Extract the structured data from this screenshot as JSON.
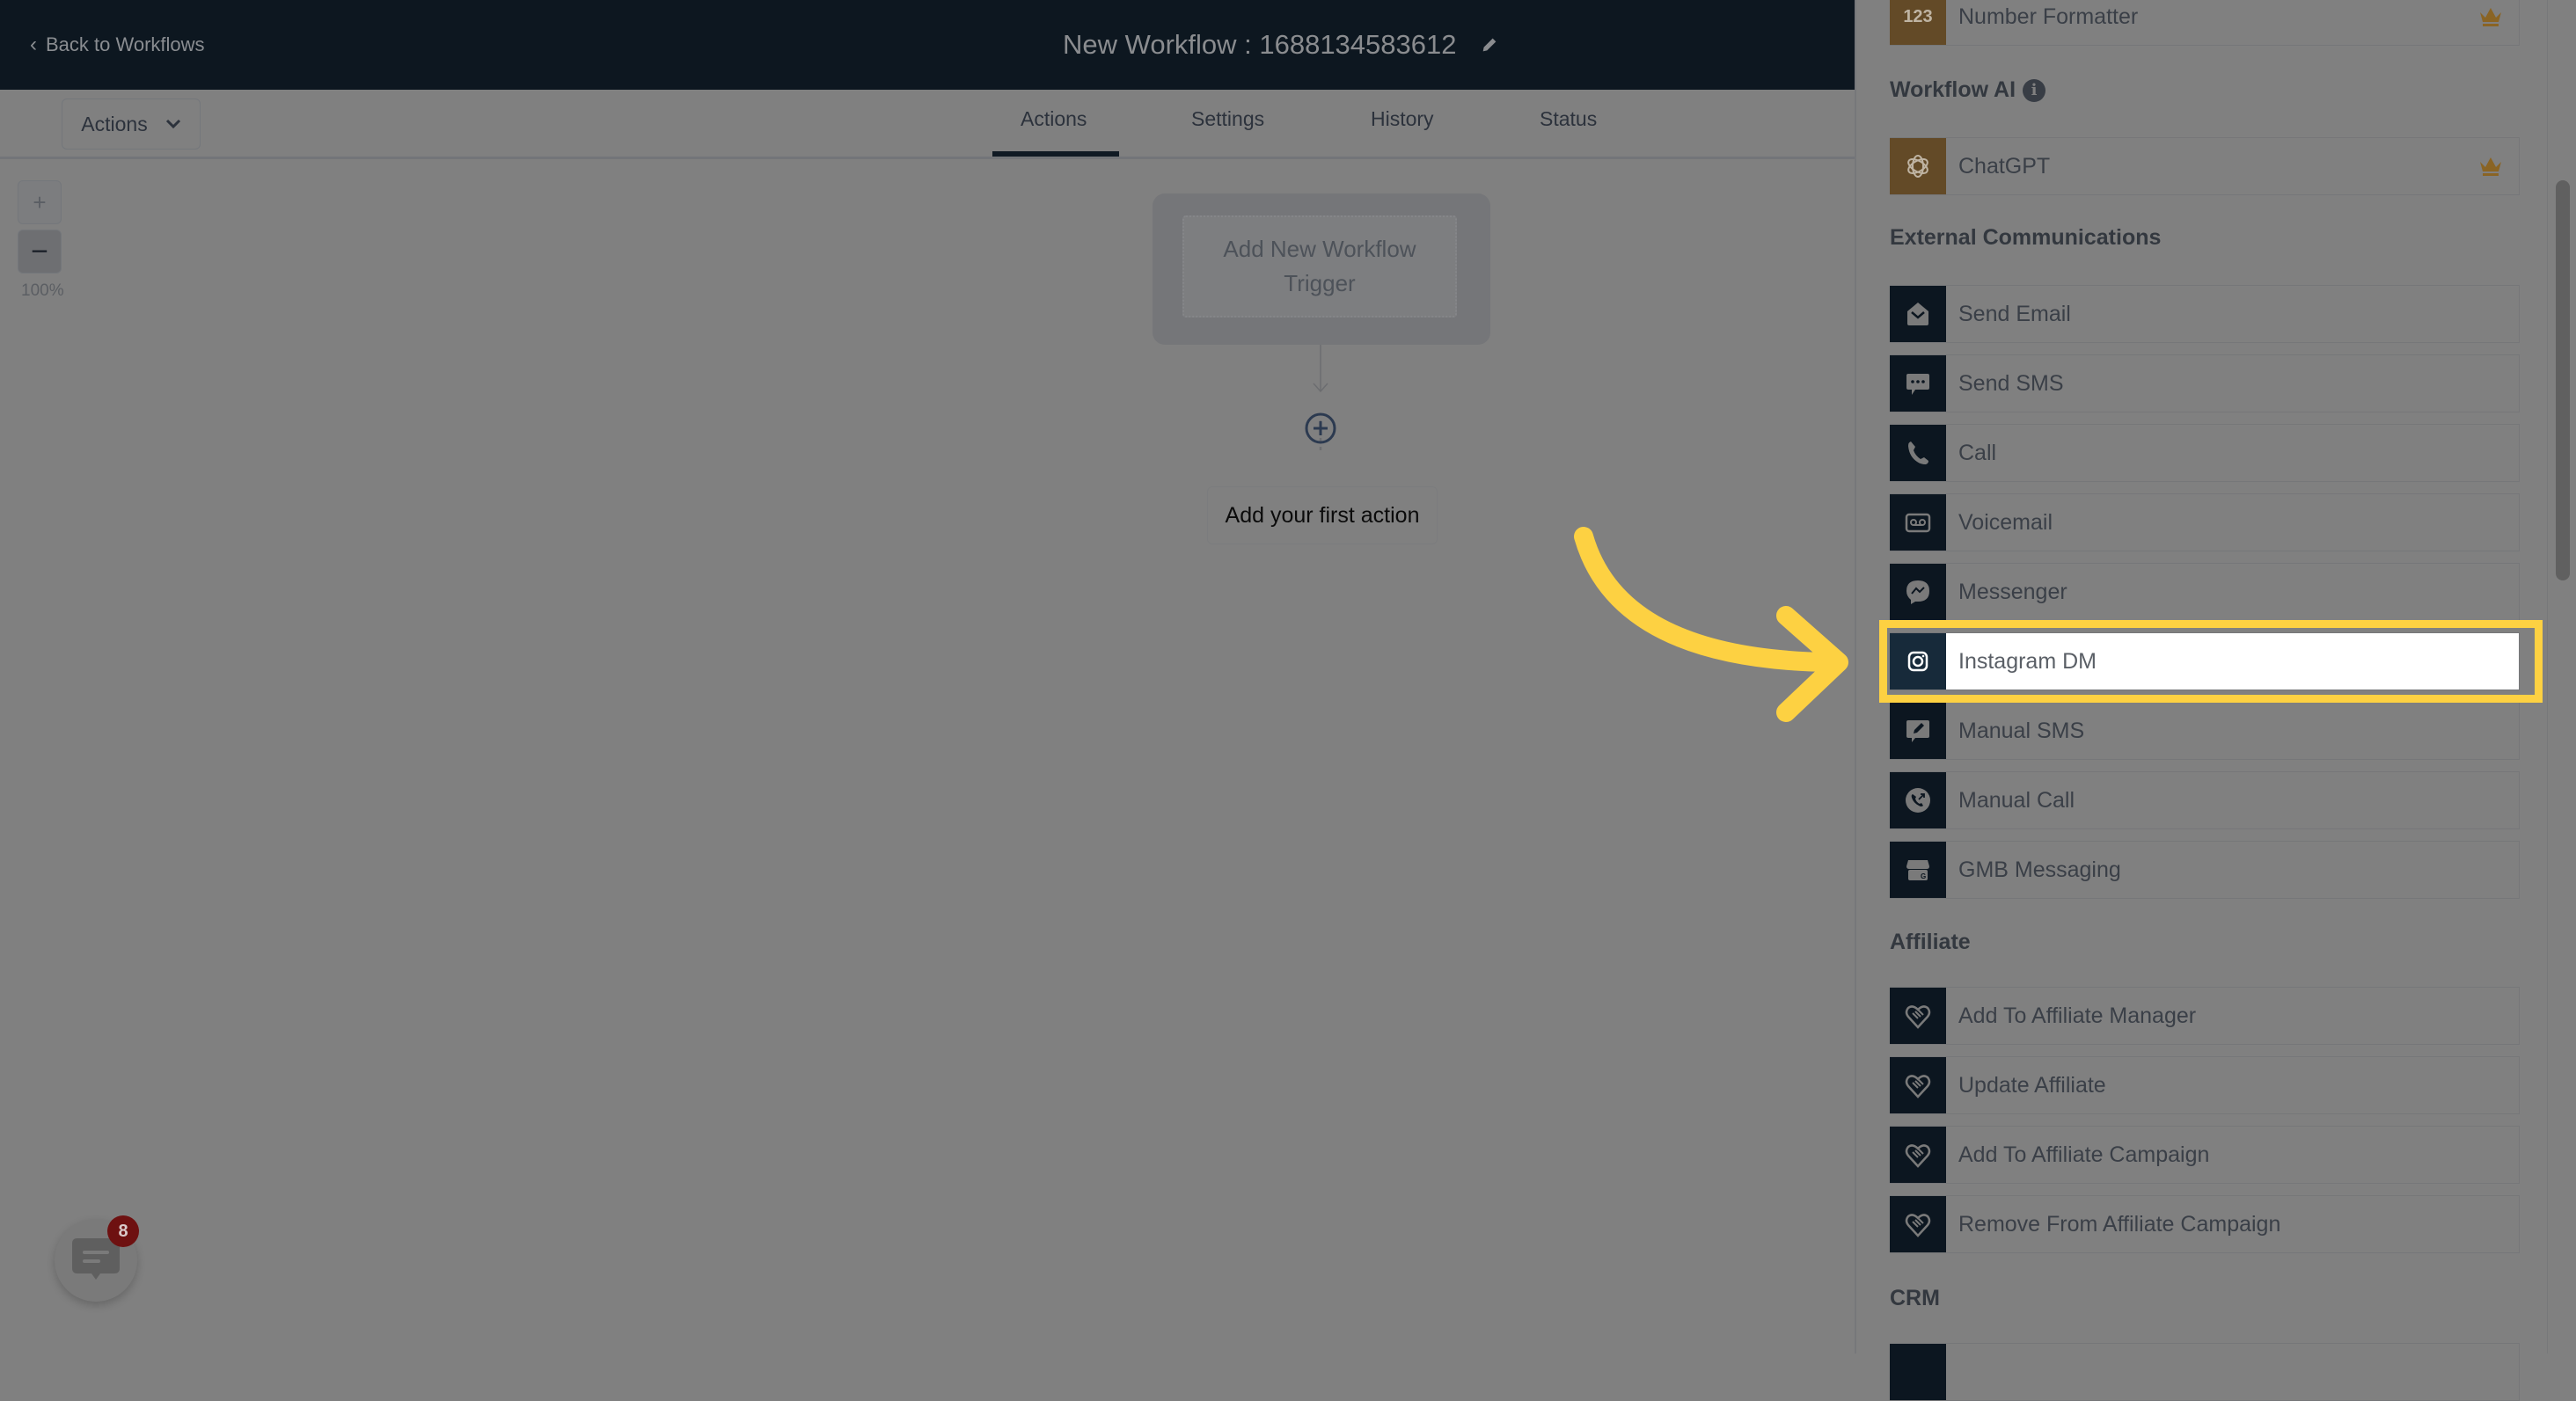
{
  "header": {
    "back_label": "Back to Workflows",
    "workflow_title": "New Workflow : 1688134583612"
  },
  "subbar": {
    "actions_dropdown": "Actions",
    "tabs": [
      {
        "label": "Actions",
        "active": true
      },
      {
        "label": "Settings",
        "active": false
      },
      {
        "label": "History",
        "active": false
      },
      {
        "label": "Status",
        "active": false
      }
    ]
  },
  "canvas": {
    "zoom_in": "+",
    "zoom_out": "−",
    "zoom_level": "100%",
    "trigger_label": "Add New Workflow Trigger",
    "first_action_label": "Add your first action",
    "chat_badge_count": "8"
  },
  "panel": {
    "sections": [
      {
        "title": "",
        "items": [
          {
            "label": "Number Formatter",
            "icon": "number-123-icon",
            "premium": true
          }
        ]
      },
      {
        "title": "Workflow AI",
        "info": true,
        "items": [
          {
            "label": "ChatGPT",
            "icon": "openai-icon",
            "premium": true
          }
        ]
      },
      {
        "title": "External Communications",
        "items": [
          {
            "label": "Send Email",
            "icon": "envelope-open-icon"
          },
          {
            "label": "Send SMS",
            "icon": "chat-bubble-dots-icon"
          },
          {
            "label": "Call",
            "icon": "phone-icon"
          },
          {
            "label": "Voicemail",
            "icon": "voicemail-icon"
          },
          {
            "label": "Messenger",
            "icon": "messenger-icon"
          },
          {
            "label": "Instagram DM",
            "icon": "instagram-icon",
            "highlighted": true
          },
          {
            "label": "Manual SMS",
            "icon": "manual-sms-icon"
          },
          {
            "label": "Manual Call",
            "icon": "manual-call-icon"
          },
          {
            "label": "GMB Messaging",
            "icon": "gmb-store-icon"
          }
        ]
      },
      {
        "title": "Affiliate",
        "items": [
          {
            "label": "Add To Affiliate Manager",
            "icon": "handshake-heart-icon"
          },
          {
            "label": "Update Affiliate",
            "icon": "handshake-heart-icon"
          },
          {
            "label": "Add To Affiliate Campaign",
            "icon": "handshake-heart-icon"
          },
          {
            "label": "Remove From Affiliate Campaign",
            "icon": "handshake-heart-icon"
          }
        ]
      },
      {
        "title": "CRM",
        "items": []
      }
    ]
  },
  "colors": {
    "header_bg": "#0d1720",
    "overlay_gray": "#808080",
    "icon_tile_dark": "#0c1620",
    "icon_tile_gold": "#634a27",
    "highlight_yellow": "#fdd142",
    "crown_gold": "#8a6424",
    "badge_red": "#6e1111"
  }
}
